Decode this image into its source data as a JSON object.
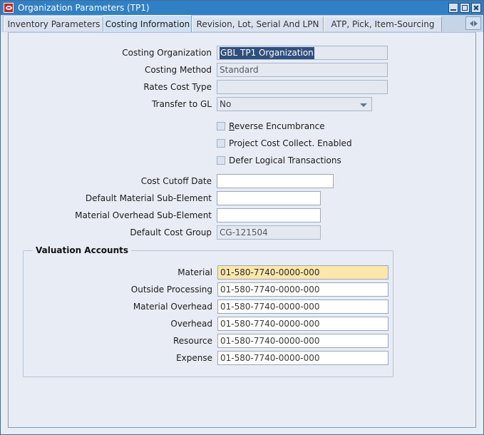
{
  "window": {
    "title": "Organization Parameters (TP1)",
    "icon": "oracle-logo-icon",
    "buttons": {
      "minimize": "minimize-icon",
      "maximize": "maximize-icon",
      "close": "close-icon"
    },
    "titlebar_color": "#2f80c4"
  },
  "tabs": [
    {
      "label": "Inventory Parameters",
      "selected": false
    },
    {
      "label": "Costing Information",
      "selected": true
    },
    {
      "label": "Revision, Lot, Serial And LPN",
      "selected": false
    },
    {
      "label": "ATP, Pick, Item-Sourcing",
      "selected": false
    }
  ],
  "tab_scroll": {
    "left_icon": "triangle-left-icon",
    "right_icon": "triangle-right-icon"
  },
  "form": {
    "fields": [
      {
        "label": "Costing Organization",
        "value": "GBL TP1 Organization",
        "state": "disabled-selected"
      },
      {
        "label": "Costing Method",
        "value": "Standard",
        "state": "disabled"
      },
      {
        "label": "Rates Cost Type",
        "value": "",
        "state": "disabled"
      },
      {
        "label": "Transfer to GL",
        "value": "No",
        "state": "dropdown"
      }
    ],
    "checkboxes": [
      {
        "label": "Reverse Encumbrance",
        "mnemonic": "R",
        "checked": false
      },
      {
        "label": "Project Cost Collect. Enabled",
        "mnemonic": "",
        "checked": false
      },
      {
        "label": "Defer Logical Transactions",
        "mnemonic": "",
        "checked": false
      }
    ],
    "fields2": [
      {
        "label": "Cost Cutoff Date",
        "value": "",
        "state": "editable"
      },
      {
        "label": "Default Material Sub-Element",
        "value": "",
        "state": "editable"
      },
      {
        "label": "Material Overhead Sub-Element",
        "value": "",
        "state": "editable"
      },
      {
        "label": "Default Cost Group",
        "value": "CG-121504",
        "state": "disabled"
      }
    ]
  },
  "valuation_accounts": {
    "title": "Valuation Accounts",
    "rows": [
      {
        "label": "Material",
        "value": "01-580-7740-0000-000",
        "state": "highlight"
      },
      {
        "label": "Outside Processing",
        "value": "01-580-7740-0000-000",
        "state": "editable"
      },
      {
        "label": "Material Overhead",
        "value": "01-580-7740-0000-000",
        "state": "editable"
      },
      {
        "label": "Overhead",
        "value": "01-580-7740-0000-000",
        "state": "editable"
      },
      {
        "label": "Resource",
        "value": "01-580-7740-0000-000",
        "state": "editable"
      },
      {
        "label": "Expense",
        "value": "01-580-7740-0000-000",
        "state": "editable"
      }
    ],
    "highlight_color": "#fce7a8"
  }
}
